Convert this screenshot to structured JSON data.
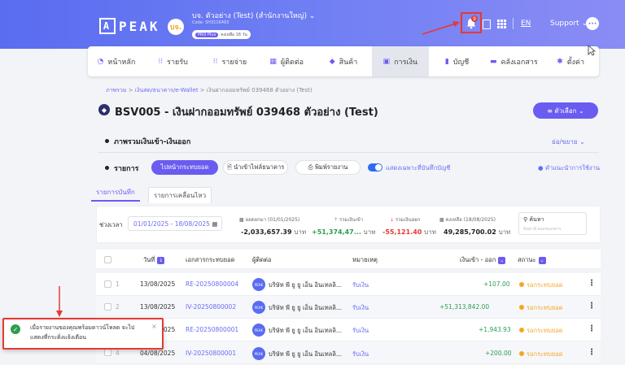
{
  "header": {
    "logo_box": "A",
    "logo_text": "PEAK",
    "company_avatar": "บจ.",
    "company_name": "บจ. ตัวอย่าง (Test) (สำนักงานใหญ่)",
    "company_code": "Code: SH3116493",
    "plan_tag": "PRO Plus",
    "plan_remaining": "คงเหลือ 16 วัน",
    "notification_count": "9",
    "language": "EN",
    "support": "Support",
    "support_avatar": "•••"
  },
  "nav": {
    "items": [
      {
        "icon": "◔",
        "label": "หน้าหลัก"
      },
      {
        "icon": "⁝⁝",
        "label": "รายรับ"
      },
      {
        "icon": "⁝⁝",
        "label": "รายจ่าย"
      },
      {
        "icon": "▦",
        "label": "ผู้ติดต่อ"
      },
      {
        "icon": "◆",
        "label": "สินค้า"
      },
      {
        "icon": "▣",
        "label": "การเงิน"
      },
      {
        "icon": "▮",
        "label": "บัญชี"
      },
      {
        "icon": "▬",
        "label": "คลังเอกสาร"
      },
      {
        "icon": "✱",
        "label": "ตั้งค่า"
      }
    ],
    "active_index": 5
  },
  "breadcrumb": {
    "root": "ภาพรวม",
    "sep1": ">",
    "middle": "เงินสด/ธนาคาร/e-Wallet",
    "sep2": ">",
    "current": "เงินฝากออมทรัพย์ 039468 ตัวอย่าง (Test)"
  },
  "page": {
    "title": "BSV005 - เงินฝากออมทรัพย์ 039468 ตัวอย่าง (Test)",
    "options_button": "≡ ตัวเลือก  ⌄"
  },
  "summary": {
    "title": "ภาพรวมเงินเข้า-เงินออก",
    "expand": "ย่อ/ขยาย ⌄"
  },
  "list_section": {
    "title": "รายการ",
    "reconcile_button": "ไปหน้ากระทบยอด",
    "import_button": "นำเข้าไฟล์ธนาคาร",
    "print_button": "พิมพ์รายงาน",
    "toggle_label": "แสดงเฉพาะที่บันทึกบัญชี",
    "help_link": "คำแนะนำการใช้งาน"
  },
  "tabs": {
    "tab1": "รายการบันทึก",
    "tab2": "รายการเคลื่อนไหว"
  },
  "filters": {
    "period_label": "ช่วงเวลา",
    "period_value": "01/01/2025 - 18/08/2025",
    "opening_label": "ยอดยกมา (01/01/2025)",
    "opening_value": "-2,033,657.39",
    "in_label": "รวมเงินเข้า",
    "in_value": "+51,374,47...",
    "out_label": "รวมเงินออก",
    "out_value": "-55,121.40",
    "balance_label": "คงเหลือ (18/08/2025)",
    "balance_value": "49,285,700.02",
    "unit": "บาท",
    "search_label": "ค้นหา",
    "search_placeholder": "ค้นหาด้วยเลขเอกสาร"
  },
  "table": {
    "headers": {
      "date": "วันที่",
      "doc": "เอกสารกระทบยอด",
      "contact": "ผู้ติดต่อ",
      "note": "หมายเหตุ",
      "amount": "เงินเข้า - ออก",
      "status": "สถานะ"
    },
    "rows": [
      {
        "no": "1",
        "date": "13/08/2025",
        "doc": "RE-20250800004",
        "contact": "บริษัท พี ยู ยู เอ็น อินเทลลิ...",
        "note": "รับเงิน",
        "amount": "+107.00",
        "status": "รอกระทบยอด"
      },
      {
        "no": "2",
        "date": "13/08/2025",
        "doc": "IV-20250800002",
        "contact": "บริษัท พี ยู ยู เอ็น อินเทลลิ...",
        "note": "รับเงิน",
        "amount": "+51,313,842.00",
        "status": "รอกระทบยอด"
      },
      {
        "no": "3",
        "date": "13/08/2025",
        "doc": "RE-20250800001",
        "contact": "บริษัท พี ยู ยู เอ็น อินเทลลิ...",
        "note": "รับเงิน",
        "amount": "+1,943.93",
        "status": "รอกระทบยอด"
      },
      {
        "no": "4",
        "date": "04/08/2025",
        "doc": "IV-20250800001",
        "contact": "บริษัท พี ยู ยู เอ็น อินเทลลิ...",
        "note": "รับเงิน",
        "amount": "+200.00",
        "status": "รอกระทบยอด"
      }
    ],
    "contact_logo": "PEAK"
  },
  "toast": {
    "message": "เมื่อรายงานของคุณพร้อมดาวน์โหลด จะไปแสดงที่กระดิ่งแจ้งเตือน",
    "check": "✓",
    "close": "×"
  },
  "colors": {
    "accent": "#6a5cf0",
    "success": "#2e9d4f",
    "warning": "#f5a623",
    "danger": "#e53935"
  }
}
